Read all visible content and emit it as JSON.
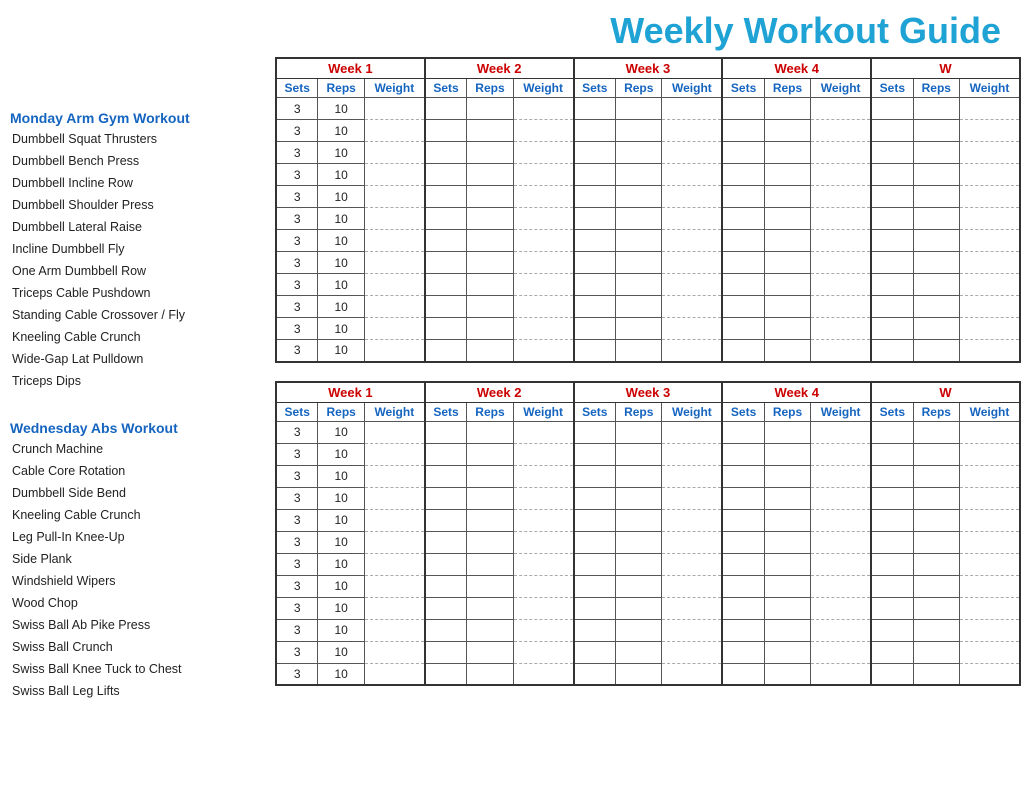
{
  "title": "Weekly Workout Guide",
  "sections": [
    {
      "id": "monday",
      "label": "Monday Arm Gym Workout",
      "exercises": [
        "Dumbbell Squat Thrusters",
        "Dumbbell Bench Press",
        "Dumbbell Incline Row",
        "Dumbbell Shoulder Press",
        "Dumbbell Lateral Raise",
        "Incline Dumbbell Fly",
        "One Arm Dumbbell Row",
        "Triceps Cable Pushdown",
        "Standing Cable Crossover / Fly",
        "Kneeling Cable Crunch",
        "Wide-Gap Lat Pulldown",
        "Triceps Dips"
      ]
    },
    {
      "id": "wednesday",
      "label": "Wednesday Abs Workout",
      "exercises": [
        "Crunch Machine",
        "Cable Core Rotation",
        "Dumbbell Side Bend",
        "Kneeling Cable Crunch",
        "Leg Pull-In Knee-Up",
        "Side Plank",
        "Windshield Wipers",
        "Wood Chop",
        "Swiss Ball Ab Pike Press",
        "Swiss Ball Crunch",
        "Swiss Ball Knee Tuck to Chest",
        "Swiss Ball Leg Lifts"
      ]
    }
  ],
  "weeks": [
    "Week 1",
    "Week 2",
    "Week 3",
    "Week 4",
    "W"
  ],
  "col_headers": [
    "Sets",
    "Reps",
    "Weight"
  ],
  "default_sets": "3",
  "default_reps": "10"
}
